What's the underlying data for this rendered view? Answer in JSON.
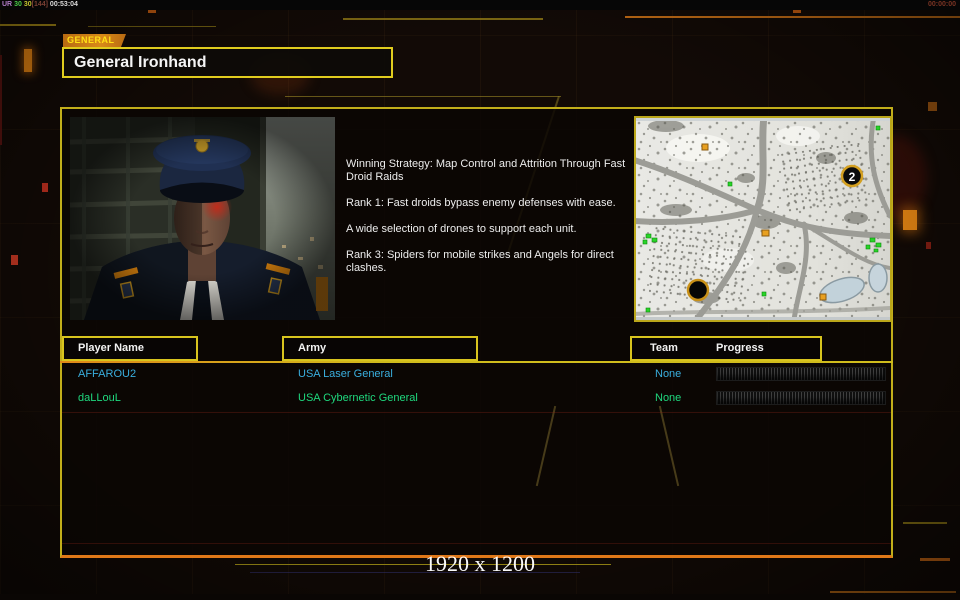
{
  "overlay": {
    "netstat": {
      "label": "UR",
      "upload": "30",
      "download": "30",
      "ping_bracket": "[144]",
      "clock": "00:53:04"
    },
    "match_timer": "00:00:00",
    "resolution_label": "1920 x 1200"
  },
  "header": {
    "tab_label": "GENERAL",
    "general_name": "General Ironhand"
  },
  "strategy": {
    "paragraphs": [
      "Winning Strategy: Map Control and Attrition Through Fast Droid Raids",
      "Rank 1: Fast droids bypass enemy defenses with ease.",
      "A wide selection of drones to support each unit.",
      "Rank 3: Spiders for mobile strikes and Angels for direct clashes."
    ]
  },
  "minimap": {
    "terrain": "snow",
    "spawn_points": [
      {
        "label": "2"
      },
      {
        "label": ""
      }
    ]
  },
  "players_table": {
    "headers": {
      "player": "Player Name",
      "army": "Army",
      "team": "Team",
      "progress": "Progress"
    },
    "rows": [
      {
        "player": "AFFAROU2",
        "army": "USA Laser General",
        "team": "None",
        "color": "#3aaede"
      },
      {
        "player": "daLLouL",
        "army": "USA Cybernetic General",
        "team": "None",
        "color": "#1fd87e"
      }
    ]
  },
  "colors": {
    "accent_yellow": "#d8c41e",
    "accent_orange": "#e07818",
    "row_player_1": "#3aaede",
    "row_player_2": "#1fd87e",
    "text_primary": "#f2f2f2"
  }
}
